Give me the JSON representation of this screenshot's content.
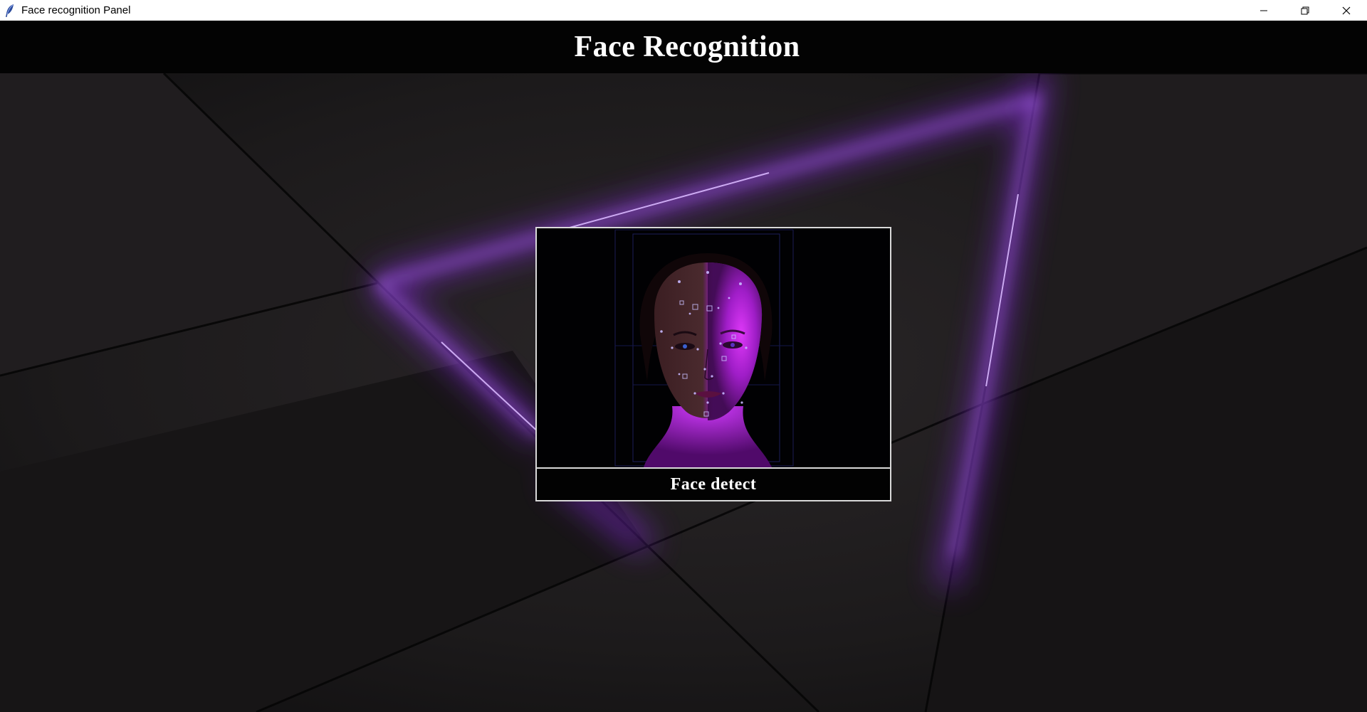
{
  "window": {
    "title": "Face recognition Panel",
    "controls": [
      "minimize",
      "restore",
      "close"
    ]
  },
  "header": {
    "title": "Face Recognition"
  },
  "card": {
    "image_icon": "face-scan-image",
    "button_label": "Face detect"
  },
  "colors": {
    "accent": "#9b3cff",
    "face_glow": "#d21cff",
    "header_bg": "#030303",
    "background": "#1a1819"
  }
}
